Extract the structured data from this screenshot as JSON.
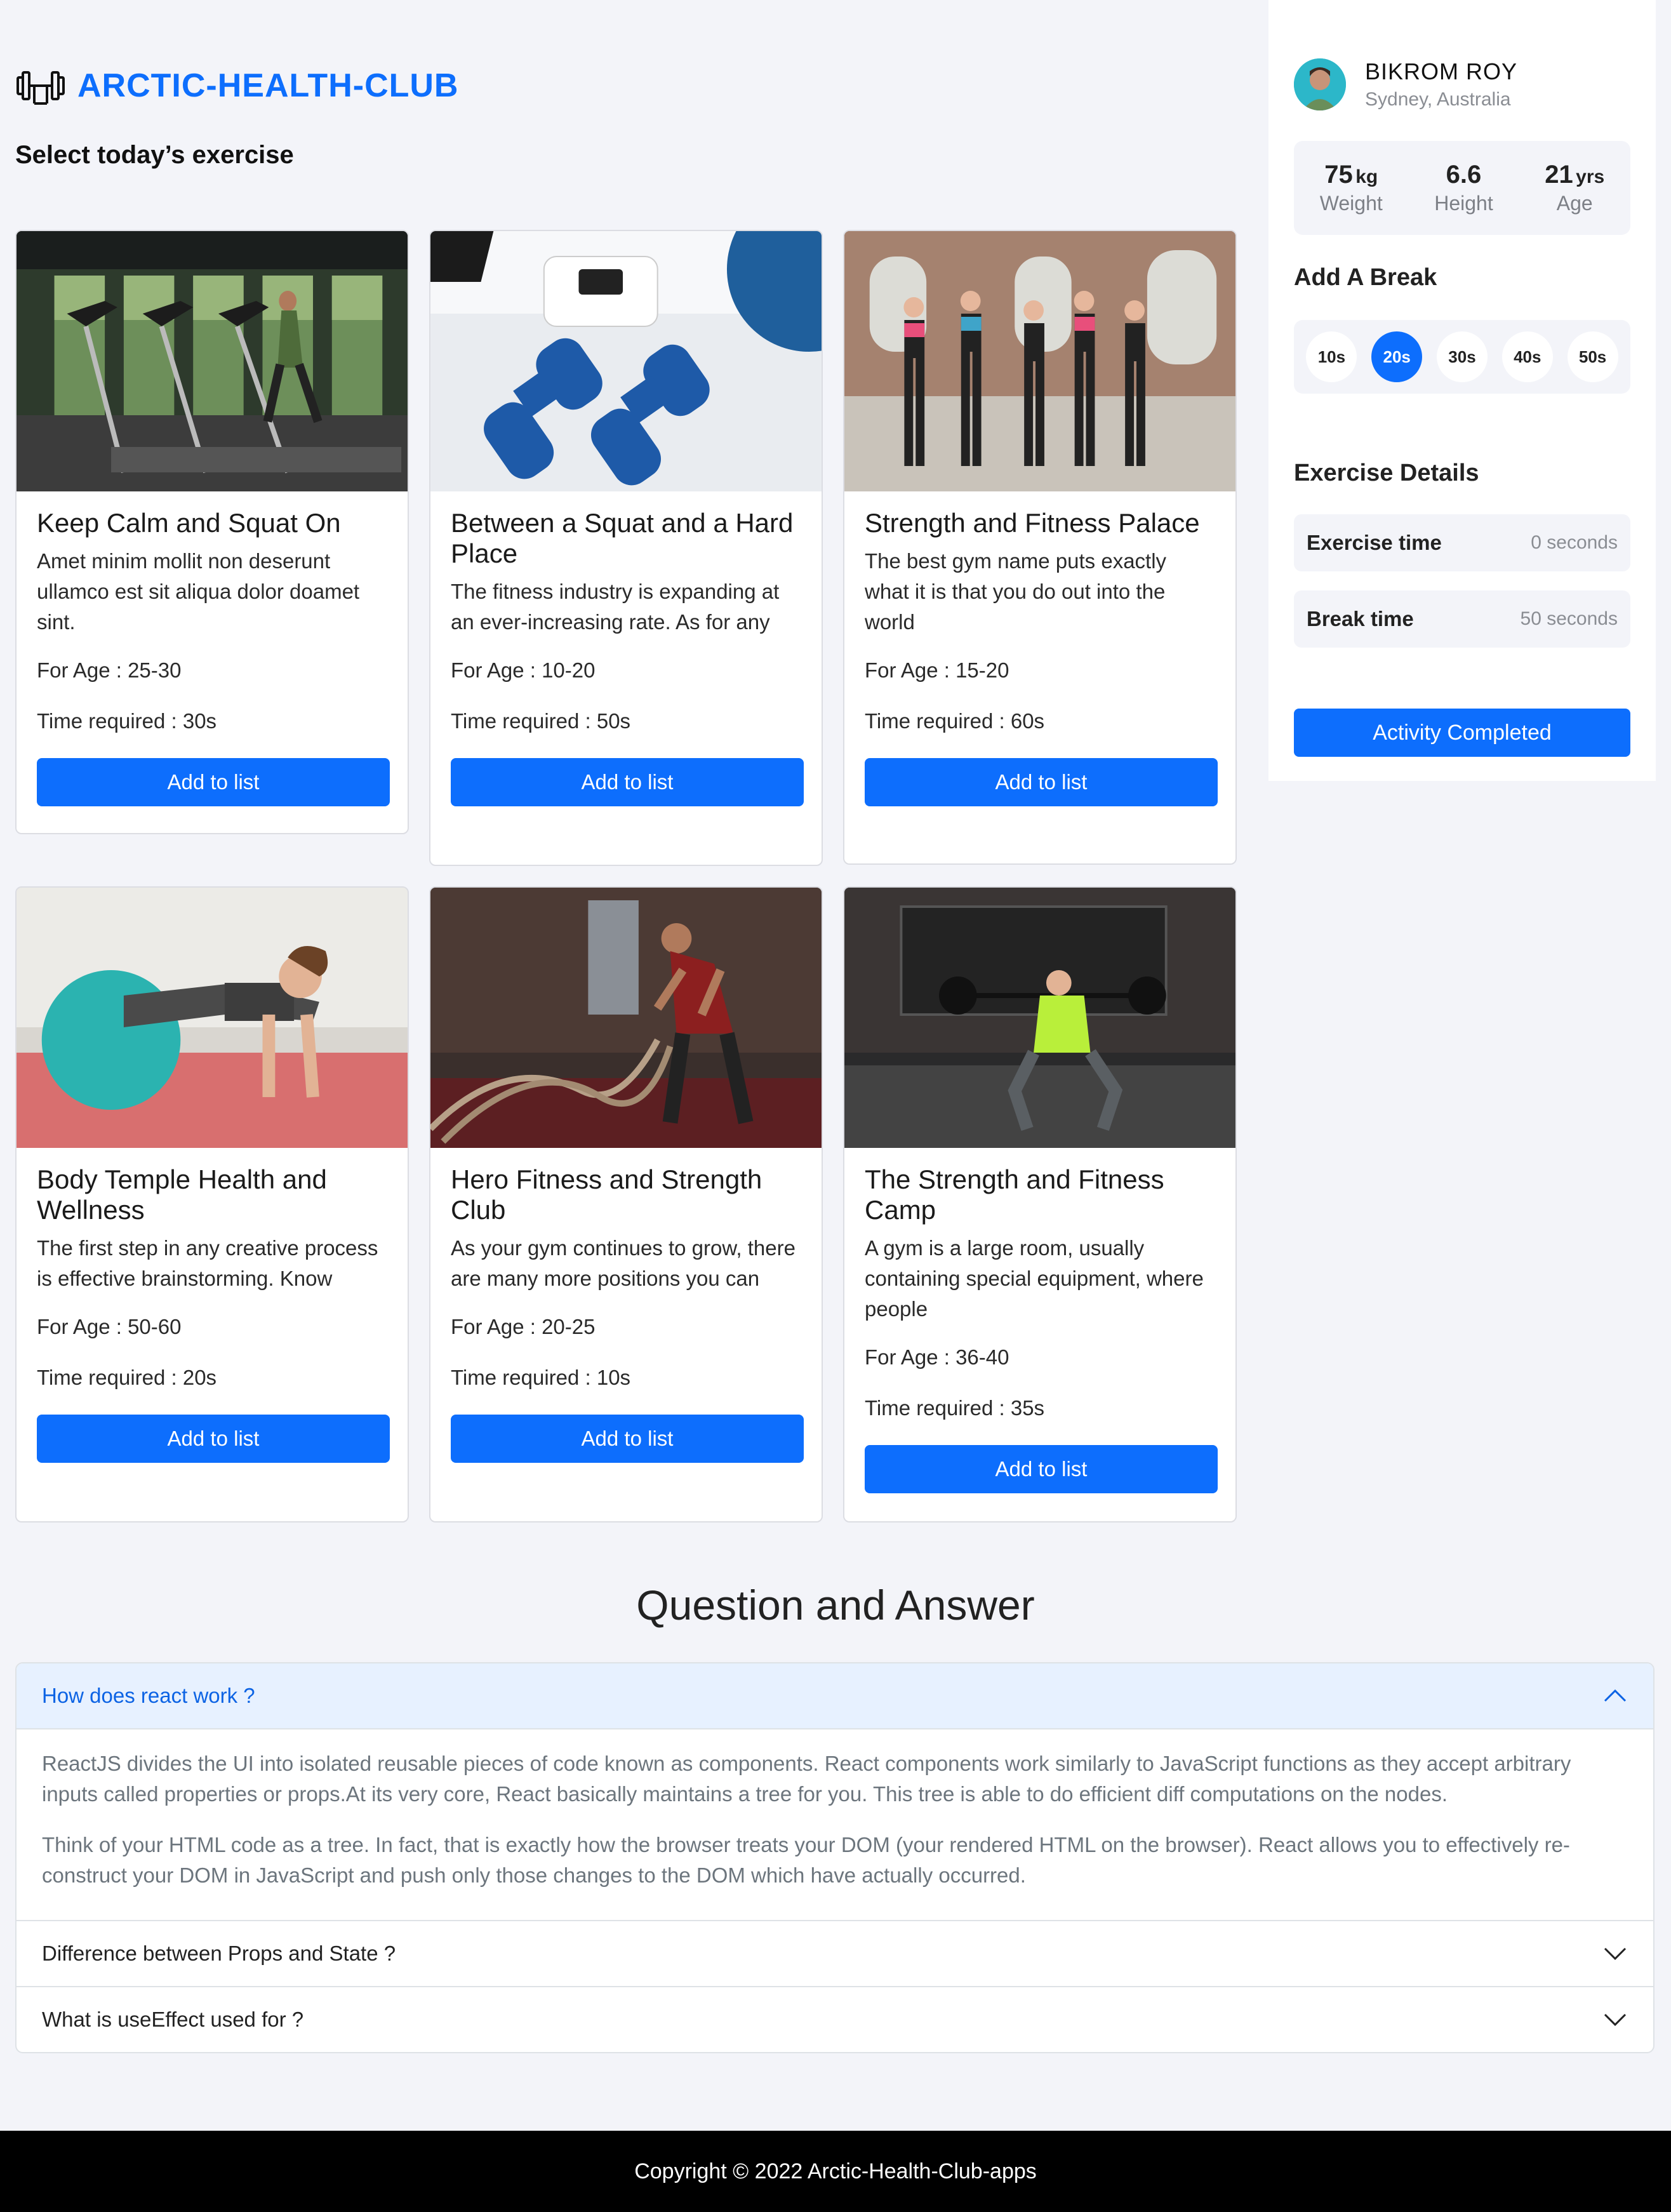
{
  "brand": {
    "name": "ARCTIC-HEALTH-CLUB",
    "icon": "dumbbell-icon",
    "color": "#0d6efd"
  },
  "section_title": "Select today’s exercise",
  "cards": [
    {
      "title": "Keep Calm and Squat On",
      "desc": "Amet minim mollit non deserunt ullamco est sit aliqua dolor doamet sint.",
      "age": "For Age : 25-30",
      "time": "Time required : 30s",
      "button": "Add to list"
    },
    {
      "title": "Between a Squat and a Hard Place",
      "desc": "The fitness industry is expanding at an ever-increasing rate. As for any",
      "age": "For Age : 10-20",
      "time": "Time required : 50s",
      "button": "Add to list"
    },
    {
      "title": "Strength and Fitness Palace",
      "desc": "The best gym name puts exactly what it is that you do out into the world",
      "age": "For Age : 15-20",
      "time": "Time required : 60s",
      "button": "Add to list"
    },
    {
      "title": "Body Temple Health and Wellness",
      "desc": "The first step in any creative process is effective brainstorming. Know",
      "age": "For Age : 50-60",
      "time": "Time required : 20s",
      "button": "Add to list"
    },
    {
      "title": "Hero Fitness and Strength Club",
      "desc": "As your gym continues to grow, there are many more positions you can",
      "age": "For Age : 20-25",
      "time": "Time required : 10s",
      "button": "Add to list"
    },
    {
      "title": "The Strength and Fitness Camp",
      "desc": "A gym is a large room, usually containing special equipment, where people",
      "age": "For Age : 36-40",
      "time": "Time required : 35s",
      "button": "Add to list"
    }
  ],
  "profile": {
    "name": "BIKROM ROY",
    "location": "Sydney, Australia",
    "stats": [
      {
        "value": "75",
        "unit": "kg",
        "label": "Weight"
      },
      {
        "value": "6.6",
        "unit": "",
        "label": "Height"
      },
      {
        "value": "21",
        "unit": "yrs",
        "label": "Age"
      }
    ]
  },
  "break": {
    "title": "Add A Break",
    "options": [
      "10s",
      "20s",
      "30s",
      "40s",
      "50s"
    ],
    "selected": "20s"
  },
  "details": {
    "title": "Exercise Details",
    "exercise_label": "Exercise time",
    "exercise_value": "0 seconds",
    "break_label": "Break time",
    "break_value": "50 seconds",
    "button": "Activity Completed"
  },
  "qa": {
    "title": "Question and Answer",
    "items": [
      {
        "question": "How does react work ?",
        "expanded": true,
        "answer": [
          "ReactJS divides the UI into isolated reusable pieces of code known as components. React components work similarly to JavaScript functions as they accept arbitrary inputs called properties or props.At its very core, React basically maintains a tree for you. This tree is able to do efficient diff computations on the nodes.",
          "Think of your HTML code as a tree. In fact, that is exactly how the browser treats your DOM (your rendered HTML on the browser). React allows you to effectively re-construct your DOM in JavaScript and push only those changes to the DOM which have actually occurred."
        ]
      },
      {
        "question": "Difference between Props and State ?",
        "expanded": false
      },
      {
        "question": "What is useEffect used for ?",
        "expanded": false
      }
    ]
  },
  "footer": {
    "text": "Copyright © 2022 Arctic-Health-Club-apps"
  }
}
